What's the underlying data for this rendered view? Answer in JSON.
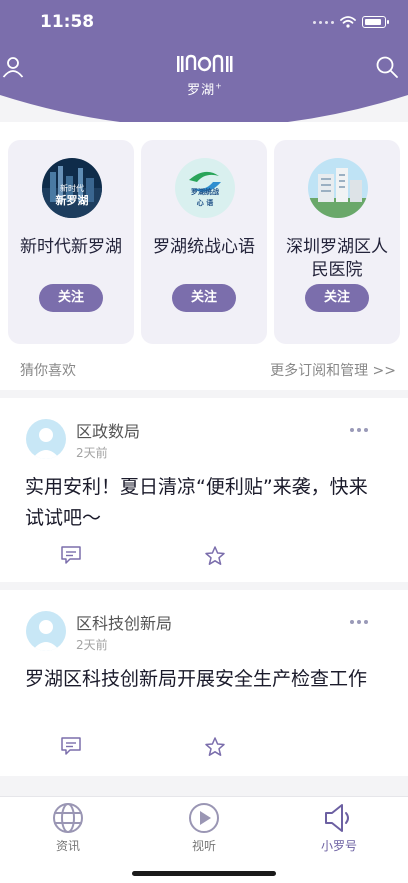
{
  "status_bar": {
    "time": "11:58"
  },
  "header": {
    "brand_name": "罗湖",
    "brand_sup": "+",
    "icons": {
      "user": "user-icon",
      "search": "search-icon"
    },
    "bg_color": "#7b6eac"
  },
  "subscriptions": {
    "cards": [
      {
        "name": "新时代新罗湖",
        "logo_text_line1": "新时代",
        "logo_text_line2": "新罗湖",
        "follow_label": "关注"
      },
      {
        "name": "罗湖统战心语",
        "logo_text_line1": "罗湖统战",
        "logo_text_line2": "心 语",
        "follow_label": "关注"
      },
      {
        "name": "深圳罗湖区人民医院",
        "follow_label": "关注"
      }
    ],
    "guess_label": "猜你喜欢",
    "more_label": "更多订阅和管理 >>"
  },
  "feed": {
    "items": [
      {
        "source": "区政数局",
        "ago": "2天前",
        "headline": "实用安利！夏日清凉“便利贴”来袭，快来试试吧～"
      },
      {
        "source": "区科技创新局",
        "ago": "2天前",
        "headline": "罗湖区科技创新局开展安全生产检查工作"
      }
    ]
  },
  "tabbar": {
    "tabs": [
      {
        "label": "资讯",
        "icon": "globe-icon"
      },
      {
        "label": "视听",
        "icon": "play-icon"
      },
      {
        "label": "小罗号",
        "icon": "megaphone-icon"
      }
    ],
    "active_color": "#6c60a2"
  }
}
